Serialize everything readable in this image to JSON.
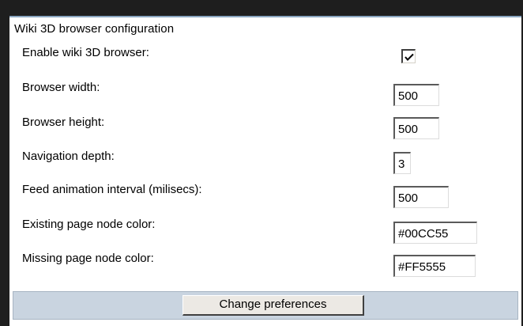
{
  "section": {
    "title": "Wiki 3D browser configuration"
  },
  "fields": {
    "enable": {
      "label": "Enable wiki 3D browser:",
      "checked": true
    },
    "width": {
      "label": "Browser width:",
      "value": "500"
    },
    "height": {
      "label": "Browser height:",
      "value": "500"
    },
    "depth": {
      "label": "Navigation depth:",
      "value": "3"
    },
    "feed": {
      "label": "Feed animation interval (milisecs):",
      "value": "500"
    },
    "existing_color": {
      "label": "Existing page node color:",
      "value": "#00CC55"
    },
    "missing_color": {
      "label": "Missing page node color:",
      "value": "#FF5555"
    }
  },
  "actions": {
    "submit_label": "Change preferences"
  },
  "colors": {
    "footer_background": "#c9d4e0",
    "panel_border": "#8aa6c1"
  }
}
